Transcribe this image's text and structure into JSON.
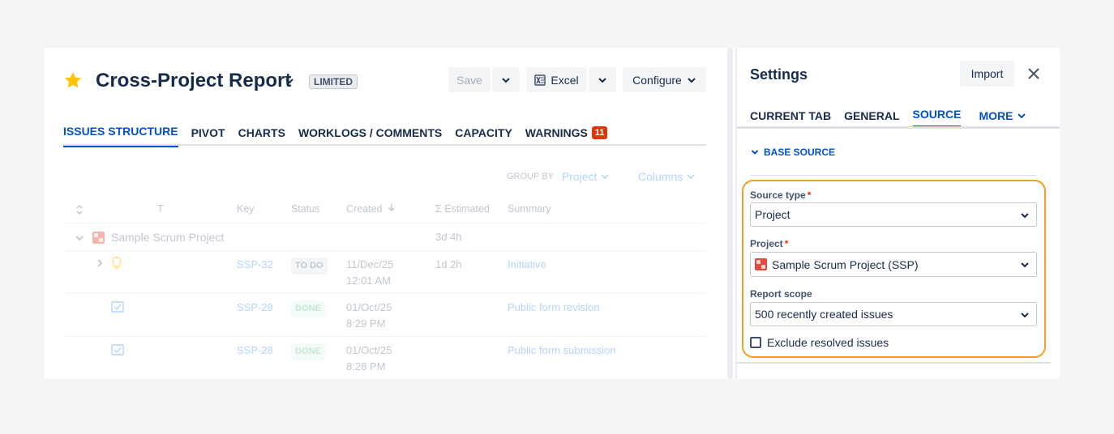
{
  "report": {
    "title": "Cross-Project Report",
    "badge": "LIMITED"
  },
  "toolbar": {
    "save_label": "Save",
    "excel_label": "Excel",
    "configure_label": "Configure"
  },
  "tabs": [
    {
      "label": "ISSUES STRUCTURE",
      "active": true
    },
    {
      "label": "PIVOT"
    },
    {
      "label": "CHARTS"
    },
    {
      "label": "WORKLOGS / COMMENTS"
    },
    {
      "label": "CAPACITY"
    },
    {
      "label": "WARNINGS",
      "count": "11"
    }
  ],
  "grouping": {
    "group_by_label": "GROUP BY",
    "group_by_value": "Project",
    "columns_label": "Columns"
  },
  "table": {
    "headers": {
      "type": "T",
      "key": "Key",
      "status": "Status",
      "created": "Created",
      "estimated": "Σ Estimated",
      "summary": "Summary"
    },
    "group": {
      "name": "Sample Scrum Project",
      "estimated": "3d 4h"
    },
    "rows": [
      {
        "key": "SSP-32",
        "status": "TO DO",
        "created_date": "11/Dec/25",
        "created_time": "12:01 AM",
        "estimated": "1d 2h",
        "summary": "Initiative"
      },
      {
        "key": "SSP-29",
        "status": "DONE",
        "created_date": "01/Oct/25",
        "created_time": "8:29 PM",
        "estimated": "",
        "summary": "Public form revision"
      },
      {
        "key": "SSP-28",
        "status": "DONE",
        "created_date": "01/Oct/25",
        "created_time": "8:28 PM",
        "estimated": "",
        "summary": "Public form submission"
      }
    ]
  },
  "settings": {
    "title": "Settings",
    "import_label": "Import",
    "tabs": [
      {
        "label": "CURRENT TAB"
      },
      {
        "label": "GENERAL"
      },
      {
        "label": "SOURCE",
        "active": true
      },
      {
        "label": "MORE"
      }
    ],
    "section_label": "BASE SOURCE",
    "source_type_label": "Source type",
    "source_type_value": "Project",
    "project_label": "Project",
    "project_value": "Sample Scrum Project (SSP)",
    "scope_label": "Report scope",
    "scope_value": "500 recently created issues",
    "exclude_label": "Exclude resolved issues",
    "required_mark": "*"
  },
  "colors": {
    "accent": "#0052cc",
    "highlight": "#f0a020",
    "warning_badge": "#de350b",
    "star": "#ffc400"
  }
}
